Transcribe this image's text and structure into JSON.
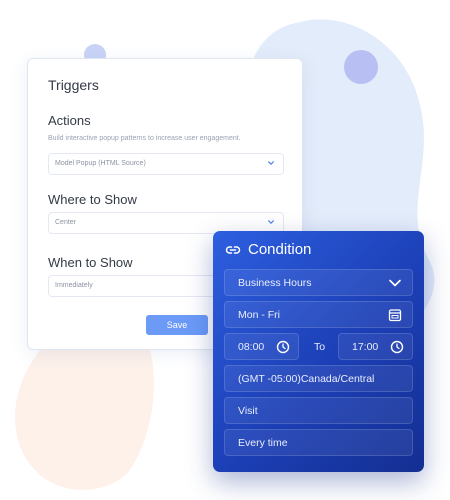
{
  "triggers": {
    "title": "Triggers",
    "actions_heading": "Actions",
    "actions_description": "Build interactive popup patterns to increase user engagement.",
    "actions_select": "Model Popup (HTML Source)",
    "where_heading": "Where to Show",
    "where_select": "Center",
    "when_heading": "When to Show",
    "when_select": "Immediately",
    "save_label": "Save"
  },
  "condition": {
    "title": "Condition",
    "schedule_select": "Business Hours",
    "days": "Mon - Fri",
    "start_time": "08:00",
    "to_label": "To",
    "end_time": "17:00",
    "timezone": "(GMT -05:00)Canada/Central",
    "event": "Visit",
    "frequency": "Every time"
  },
  "colors": {
    "accent": "#6b9af7",
    "condition_card": "#1c3fb6",
    "blob_blue": "#dfeaf9",
    "blob_peach": "#fdf1ea"
  }
}
